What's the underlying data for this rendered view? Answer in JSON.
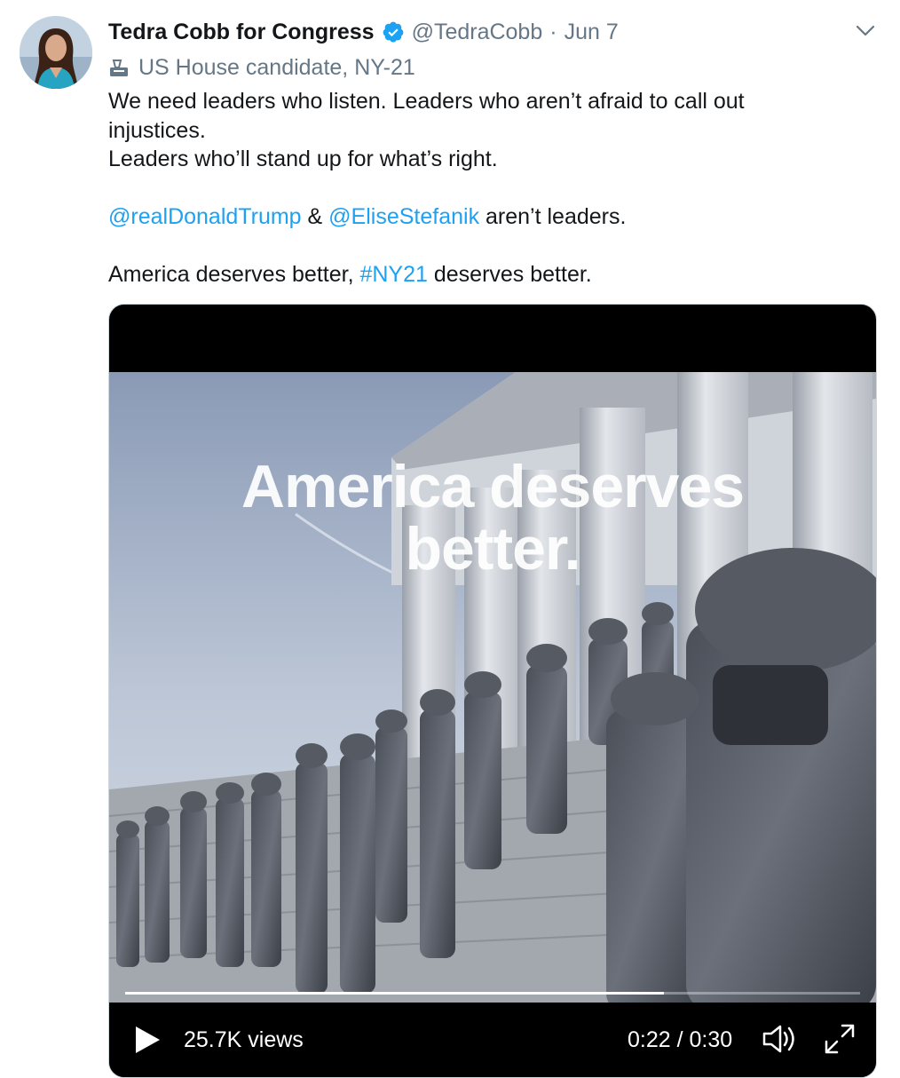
{
  "author": {
    "display_name": "Tedra Cobb for Congress",
    "handle": "@TedraCobb",
    "separator": "·",
    "date": "Jun 7",
    "verified": true,
    "label": "US House candidate, NY-21",
    "label_icon": "ballot-box-icon"
  },
  "tweet": {
    "line1": "We need leaders who listen. Leaders who aren’t afraid to call out injustices.",
    "line2": "Leaders who’ll stand up for what’s right.",
    "mention1": "@realDonaldTrump",
    "amp": " & ",
    "mention2": "@EliseStefanik",
    "line3_tail": " aren’t leaders.",
    "line4_head": "America deserves better, ",
    "hashtag": "#NY21",
    "line4_tail": " deserves better."
  },
  "video": {
    "overlay_line1": "America deserves",
    "overlay_line2": "better.",
    "views": "25.7K views",
    "time": "0:22 / 0:30",
    "progress": 0.733
  },
  "colors": {
    "link": "#1da1f2",
    "verified": "#1da1f2",
    "secondary_text": "#657786"
  }
}
